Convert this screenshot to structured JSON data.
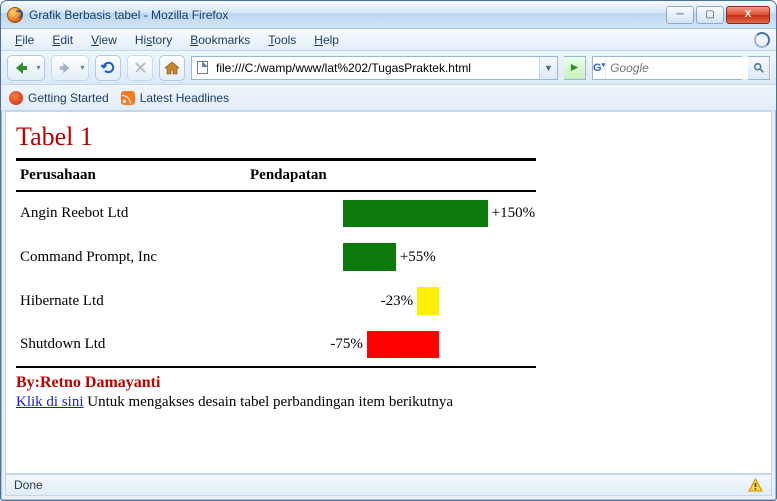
{
  "window": {
    "title": "Grafik Berbasis tabel - Mozilla Firefox"
  },
  "menu": {
    "file": "File",
    "edit": "Edit",
    "view": "View",
    "history": "History",
    "bookmarks": "Bookmarks",
    "tools": "Tools",
    "help": "Help"
  },
  "nav": {
    "url": "file:///C:/wamp/www/lat%202/TugasPraktek.html",
    "search_engine": "G",
    "search_placeholder": "Google"
  },
  "bookmarks_bar": {
    "getting_started": "Getting Started",
    "latest_headlines": "Latest Headlines"
  },
  "page": {
    "heading": "Tabel 1",
    "col_company": "Perusahaan",
    "col_income": "Pendapatan",
    "byline": "By:Retno Damayanti",
    "link_text": "Klik di sini",
    "link_tail": " Untuk mengakses desain tabel perbandingan item berikutnya"
  },
  "statusbar": {
    "text": "Done"
  },
  "chart_data": {
    "type": "bar",
    "title": "Tabel 1",
    "xlabel": "Pendapatan",
    "ylabel": "Perusahaan",
    "categories": [
      "Angin Reebot Ltd",
      "Command Prompt, Inc",
      "Hibernate Ltd",
      "Shutdown Ltd"
    ],
    "values": [
      150,
      55,
      -23,
      -75
    ],
    "value_labels": [
      "+150%",
      "+55%",
      "-23%",
      "-75%"
    ],
    "colors": [
      "#0b7a0b",
      "#0b7a0b",
      "#ffef00",
      "#ff0000"
    ],
    "xlim": [
      -100,
      200
    ]
  }
}
